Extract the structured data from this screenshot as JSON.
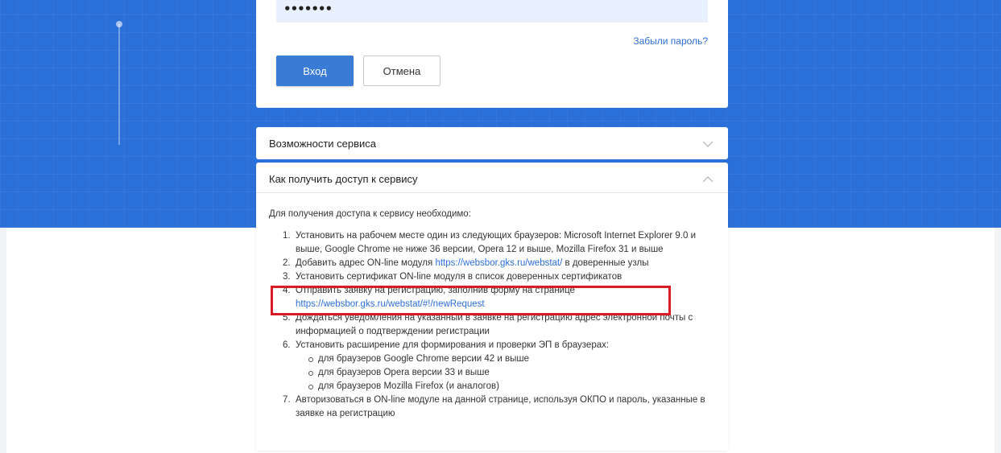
{
  "login": {
    "password_mask": "•••••••",
    "forgot_password": "Забыли пароль?",
    "login_button": "Вход",
    "cancel_button": "Отмена"
  },
  "accordion": {
    "features_title": "Возможности сервиса",
    "access_title": "Как получить доступ к сервису",
    "intro": "Для получения доступа к сервису необходимо:",
    "steps": [
      {
        "num": "1.",
        "text": "Установить на рабочем месте один из следующих браузеров: Microsoft Internet Explorer 9.0 и выше, Google Chrome не ниже 36 версии, Opera 12 и выше, Mozilla Firefox 31 и выше"
      },
      {
        "num": "2.",
        "text_before": "Добавить адрес ON-line модуля ",
        "link": "https://websbor.gks.ru/webstat/",
        "text_after": " в доверенные узлы"
      },
      {
        "num": "3.",
        "text": "Установить сертификат ON-line модуля в список доверенных сертификатов"
      },
      {
        "num": "4.",
        "text": "Отправить заявку на регистрацию, заполнив форму на странице",
        "link": "https://websbor.gks.ru/webstat/#!/newRequest"
      },
      {
        "num": "5.",
        "text": "Дождаться уведомления на указанный в заявке на регистрацию адрес электронной почты с информацией о подтверждении регистрации"
      },
      {
        "num": "6.",
        "text": "Установить расширение для формирования и проверки ЭП в браузерах:",
        "sub": [
          "для браузеров Google Chrome версии 42 и выше",
          "для браузеров Opera версии 33 и выше",
          "для браузеров Mozilla Firefox (и аналогов)"
        ]
      },
      {
        "num": "7.",
        "text": "Авторизоваться в ON-line модуле на данной странице, используя ОКПО и пароль, указанные в заявке на регистрацию"
      }
    ]
  },
  "colors": {
    "brand_blue": "#2b6fd8",
    "highlight_red": "#d81b24"
  }
}
